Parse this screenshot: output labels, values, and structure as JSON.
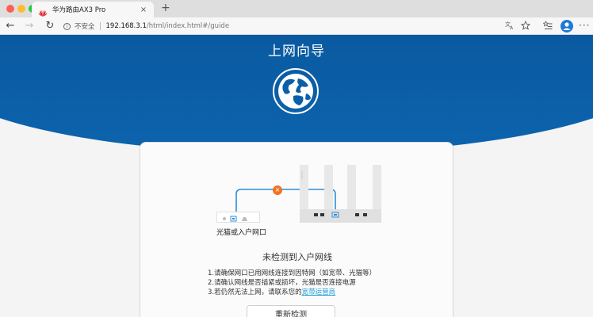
{
  "browser": {
    "tab_title": "华为路由AX3 Pro",
    "tab_close": "×",
    "new_tab": "+",
    "insecure_label": "不安全",
    "url_host": "192.168.3.1",
    "url_path": "/html/index.html#/guide",
    "back": "←",
    "forward": "→",
    "reload": "↻",
    "info": "i",
    "icons": [
      "translate-icon",
      "favorite-star-icon",
      "favorites-list-icon",
      "profile-avatar",
      "more-menu-icon"
    ],
    "more": "···"
  },
  "colors": {
    "banner": "#0a5aa1",
    "accent": "#1a9bd7",
    "error": "#f07321",
    "traffic_close": "#fe5f57",
    "traffic_min": "#febc2e",
    "traffic_max": "#28c840"
  },
  "page": {
    "title": "上网向导"
  },
  "diagram": {
    "wall_label": "光猫或入户网口",
    "error_mark": "×"
  },
  "message": {
    "title": "未检测到入户网线",
    "line1": "1.请确保网口已用网线连接到因特网（如宽带、光猫等）",
    "line2": "2.请确认网线是否插紧或损坏，光猫是否连接电源",
    "line3_prefix": "3.若仍然无法上网，请联系您的",
    "line3_link": "宽带运营商"
  },
  "actions": {
    "retry": "重新检测"
  }
}
